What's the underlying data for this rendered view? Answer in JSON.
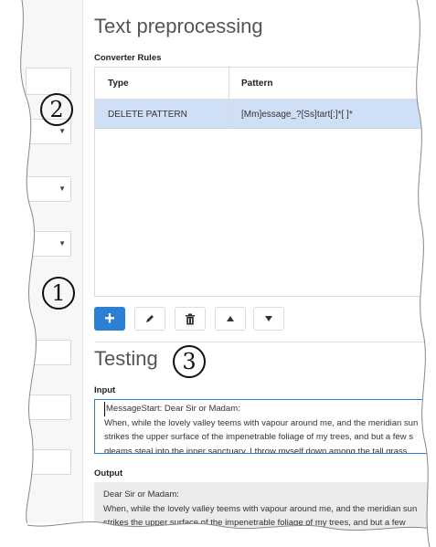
{
  "main": {
    "title": "Text preprocessing",
    "converter_rules_label": "Converter Rules",
    "table": {
      "columns": [
        "Type",
        "Pattern"
      ],
      "rows": [
        {
          "type": "DELETE PATTERN",
          "pattern": "[Mm]essage_?[Ss]tart[:]*[ ]*"
        }
      ]
    },
    "toolbar": {
      "add": "+",
      "edit_icon": "pencil-icon",
      "delete_icon": "trash-icon",
      "up_icon": "arrow-up-icon",
      "down_icon": "arrow-down-icon"
    },
    "testing": {
      "title": "Testing",
      "input_label": "Input",
      "input_lines": [
        "MessageStart: Dear Sir or Madam:",
        "When, while the lovely valley teems with vapour around me, and the meridian sun",
        "strikes the upper surface of the impenetrable foliage of my trees, and but a few s",
        "gleams steal into the inner sanctuary, I throw myself down among the tall grass"
      ],
      "output_label": "Output",
      "output_lines": [
        "Dear Sir or Madam:",
        "When, while the lovely valley teems with vapour around me, and the meridian sun",
        "strikes the upper surface of the impenetrable foliage of my trees, and but a few"
      ]
    }
  },
  "callouts": [
    "2",
    "1",
    "3"
  ],
  "colors": {
    "accent": "#2d7fd4",
    "selected_row": "#cfe0f6"
  }
}
